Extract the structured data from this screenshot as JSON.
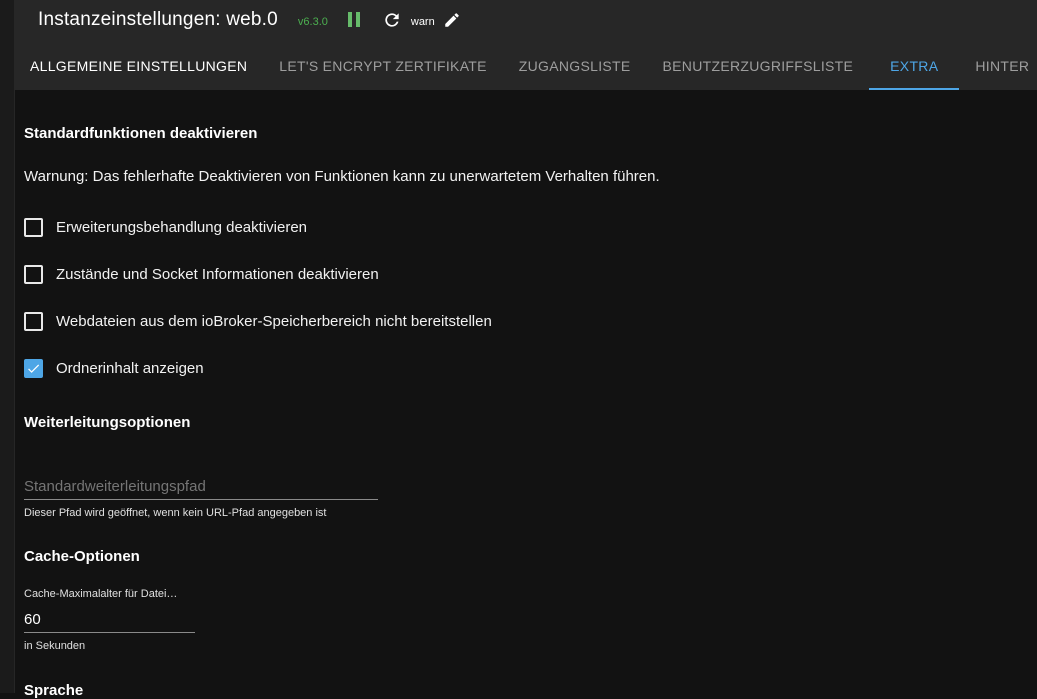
{
  "header": {
    "title": "Instanzeinstellungen: web.0",
    "version": "v6.3.0",
    "log_level": "warn",
    "icons": {
      "pause": "pause-icon",
      "reload": "reload-icon",
      "edit": "pencil-icon"
    },
    "colors": {
      "running": "#4caf50",
      "accent": "#4ea6e6"
    }
  },
  "tabs": [
    {
      "label": "ALLGEMEINE EINSTELLUNGEN",
      "state": "highlighted"
    },
    {
      "label": "LET'S ENCRYPT ZERTIFIKATE",
      "state": "inactive"
    },
    {
      "label": "ZUGANGSLISTE",
      "state": "inactive"
    },
    {
      "label": "BENUTZERZUGRIFFSLISTE",
      "state": "inactive"
    },
    {
      "label": "EXTRA",
      "state": "active"
    },
    {
      "label": "HINTER",
      "state": "inactive"
    }
  ],
  "sections": {
    "disable_features": {
      "title": "Standardfunktionen deaktivieren",
      "warning": "Warnung: Das fehlerhafte Deaktivieren von Funktionen kann zu unerwartetem Verhalten führen.",
      "checkboxes": [
        {
          "label": "Erweiterungsbehandlung deaktivieren",
          "checked": false
        },
        {
          "label": "Zustände und Socket Informationen deaktivieren",
          "checked": false
        },
        {
          "label": "Webdateien aus dem ioBroker-Speicherbereich nicht bereitstellen",
          "checked": false
        },
        {
          "label": "Ordnerinhalt anzeigen",
          "checked": true
        }
      ]
    },
    "redirect": {
      "title": "Weiterleitungsoptionen",
      "default_path_placeholder": "Standardweiterleitungspfad",
      "default_path_value": "",
      "helper": "Dieser Pfad wird geöffnet, wenn kein URL-Pfad angegeben ist"
    },
    "cache": {
      "title": "Cache-Optionen",
      "max_age_label": "Cache-Maximalalter für Datei…",
      "max_age_value": "60",
      "helper": "in Sekunden"
    },
    "language": {
      "title": "Sprache"
    }
  }
}
